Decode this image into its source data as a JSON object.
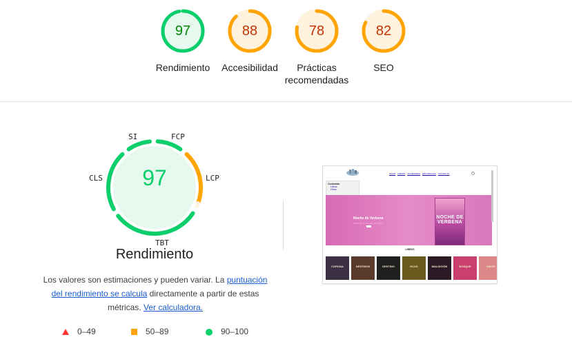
{
  "categories": [
    {
      "id": "performance",
      "score": "97",
      "label": "Rendimiento",
      "color": "#0cce6b",
      "text_color": "#008800",
      "bg": "#e6f9ee",
      "fraction": 0.97
    },
    {
      "id": "accessibility",
      "score": "88",
      "label": "Accesibilidad",
      "color": "#ffa400",
      "text_color": "#c33300",
      "bg": "#fff3e0",
      "fraction": 0.88
    },
    {
      "id": "best-practices",
      "score": "78",
      "label": "Prácticas recomendadas",
      "color": "#ffa400",
      "text_color": "#c33300",
      "bg": "#fff3e0",
      "fraction": 0.78
    },
    {
      "id": "seo",
      "score": "82",
      "label": "SEO",
      "color": "#ffa400",
      "text_color": "#c33300",
      "bg": "#fff3e0",
      "fraction": 0.82
    }
  ],
  "detail": {
    "score": "97",
    "title": "Rendimiento",
    "metrics": {
      "si": "SI",
      "fcp": "FCP",
      "lcp": "LCP",
      "tbt": "TBT",
      "cls": "CLS"
    },
    "description_prefix": "Los valores son estimaciones y pueden variar. La ",
    "description_link": "puntuación del rendimiento se calcula",
    "description_middle": " directamente a partir de estas métricas. ",
    "calculator_link": "Ver calculadora."
  },
  "legend": [
    {
      "symbol": "triangle",
      "range": "0–49",
      "color": "#ff3333"
    },
    {
      "symbol": "square",
      "range": "50–89",
      "color": "#ffa400"
    },
    {
      "symbol": "circle",
      "range": "90–100",
      "color": "#0cce6b"
    }
  ],
  "screenshot": {
    "nav_links": [
      "INICIO",
      "LIBROS",
      "NOVEDADES",
      "EDITORIALES",
      "CONTACTO"
    ],
    "sidebar_title": "Contenido",
    "sidebar_items": [
      "Libros",
      "Otros"
    ],
    "hero_title": "Noche de Verbena",
    "hero_subtitle": "Adéntrate en una nueva historia",
    "book_title": "NOCHE DE VERBENA",
    "section_title": "LIBROS",
    "cover_titles": [
      "CORONA",
      "DESTINOS",
      "DESTINO",
      "ECOS",
      "MALDICIÓN",
      "BOSQUE",
      "AMOR"
    ],
    "cover_colors": [
      "#3b3044",
      "#5a3a2a",
      "#1f1f1f",
      "#6a5a1e",
      "#2b1a24",
      "#c93f6d",
      "#d88"
    ]
  }
}
